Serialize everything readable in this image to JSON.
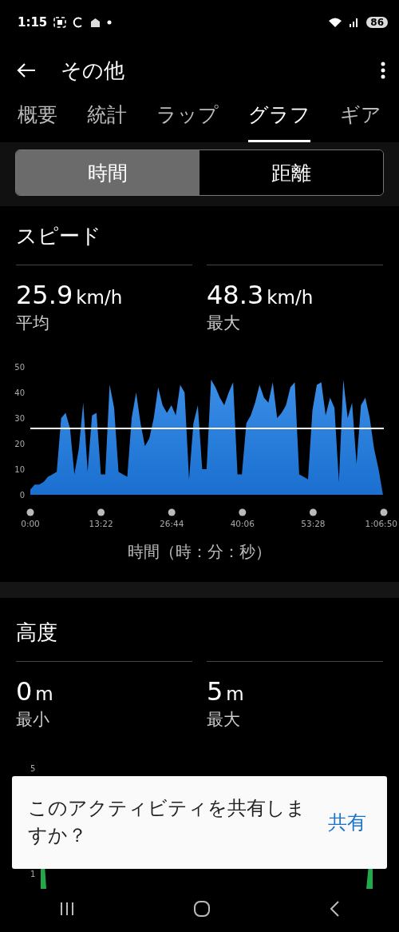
{
  "status_bar": {
    "time": "1:15",
    "battery": "86"
  },
  "header": {
    "title": "その他"
  },
  "tabs": [
    {
      "label": "概要",
      "selected": false
    },
    {
      "label": "統計",
      "selected": false
    },
    {
      "label": "ラップ",
      "selected": false
    },
    {
      "label": "グラフ",
      "selected": true
    },
    {
      "label": "ギア",
      "selected": false
    }
  ],
  "segments": [
    {
      "label": "時間",
      "selected": true
    },
    {
      "label": "距離",
      "selected": false
    }
  ],
  "speed": {
    "title": "スピード",
    "stats": [
      {
        "value": "25.9",
        "unit": "km/h",
        "label": "平均"
      },
      {
        "value": "48.3",
        "unit": "km/h",
        "label": "最大"
      }
    ],
    "chart_data": {
      "type": "area",
      "xlabel": "時間（時：分：秒）",
      "xlim": [
        0,
        4010
      ],
      "ylim": [
        0,
        50
      ],
      "yticks": [
        0,
        10,
        20,
        30,
        40,
        50
      ],
      "xticks": [
        {
          "value": 0,
          "label": "0:00"
        },
        {
          "value": 802,
          "label": "13:22"
        },
        {
          "value": 1604,
          "label": "26:44"
        },
        {
          "value": 2406,
          "label": "40:06"
        },
        {
          "value": 3208,
          "label": "53:28"
        },
        {
          "value": 4010,
          "label": "1:06:50"
        }
      ],
      "x": [
        0,
        50,
        100,
        150,
        200,
        250,
        300,
        350,
        400,
        450,
        500,
        550,
        600,
        650,
        700,
        750,
        800,
        850,
        900,
        950,
        1000,
        1050,
        1100,
        1150,
        1200,
        1250,
        1300,
        1350,
        1400,
        1450,
        1500,
        1550,
        1600,
        1650,
        1700,
        1750,
        1800,
        1850,
        1900,
        1950,
        2000,
        2050,
        2100,
        2150,
        2200,
        2250,
        2300,
        2350,
        2400,
        2450,
        2500,
        2550,
        2600,
        2650,
        2700,
        2750,
        2800,
        2850,
        2900,
        2950,
        3000,
        3050,
        3100,
        3150,
        3200,
        3250,
        3300,
        3350,
        3400,
        3450,
        3500,
        3550,
        3600,
        3650,
        3700,
        3750,
        3800,
        3850,
        3900,
        3950,
        4000
      ],
      "series": [
        {
          "color": "#3a8ee6",
          "values": [
            2,
            4,
            4,
            5,
            7,
            8,
            9,
            30,
            32,
            26,
            8,
            18,
            36,
            9,
            31,
            32,
            8,
            8,
            43,
            34,
            9,
            8,
            7,
            30,
            40,
            28,
            19,
            22,
            30,
            42,
            35,
            32,
            35,
            31,
            43,
            40,
            6,
            28,
            35,
            10,
            10,
            45,
            42,
            38,
            35,
            40,
            44,
            8,
            8,
            28,
            31,
            36,
            43,
            38,
            36,
            44,
            30,
            32,
            35,
            42,
            44,
            8,
            7,
            6,
            33,
            43,
            44,
            31,
            38,
            34,
            5,
            45,
            30,
            36,
            12,
            35,
            38,
            30,
            18,
            10,
            0
          ]
        }
      ],
      "ref_lines": [
        {
          "axis": "y",
          "value": 25.9
        }
      ]
    }
  },
  "altitude": {
    "title": "高度",
    "stats": [
      {
        "value": "0",
        "unit": "m",
        "label": "最小"
      },
      {
        "value": "5",
        "unit": "m",
        "label": "最大"
      }
    ],
    "axis_labels": [
      "5",
      "1"
    ]
  },
  "snackbar": {
    "message": "このアクティビティを共有しますか？",
    "action": "共有"
  }
}
